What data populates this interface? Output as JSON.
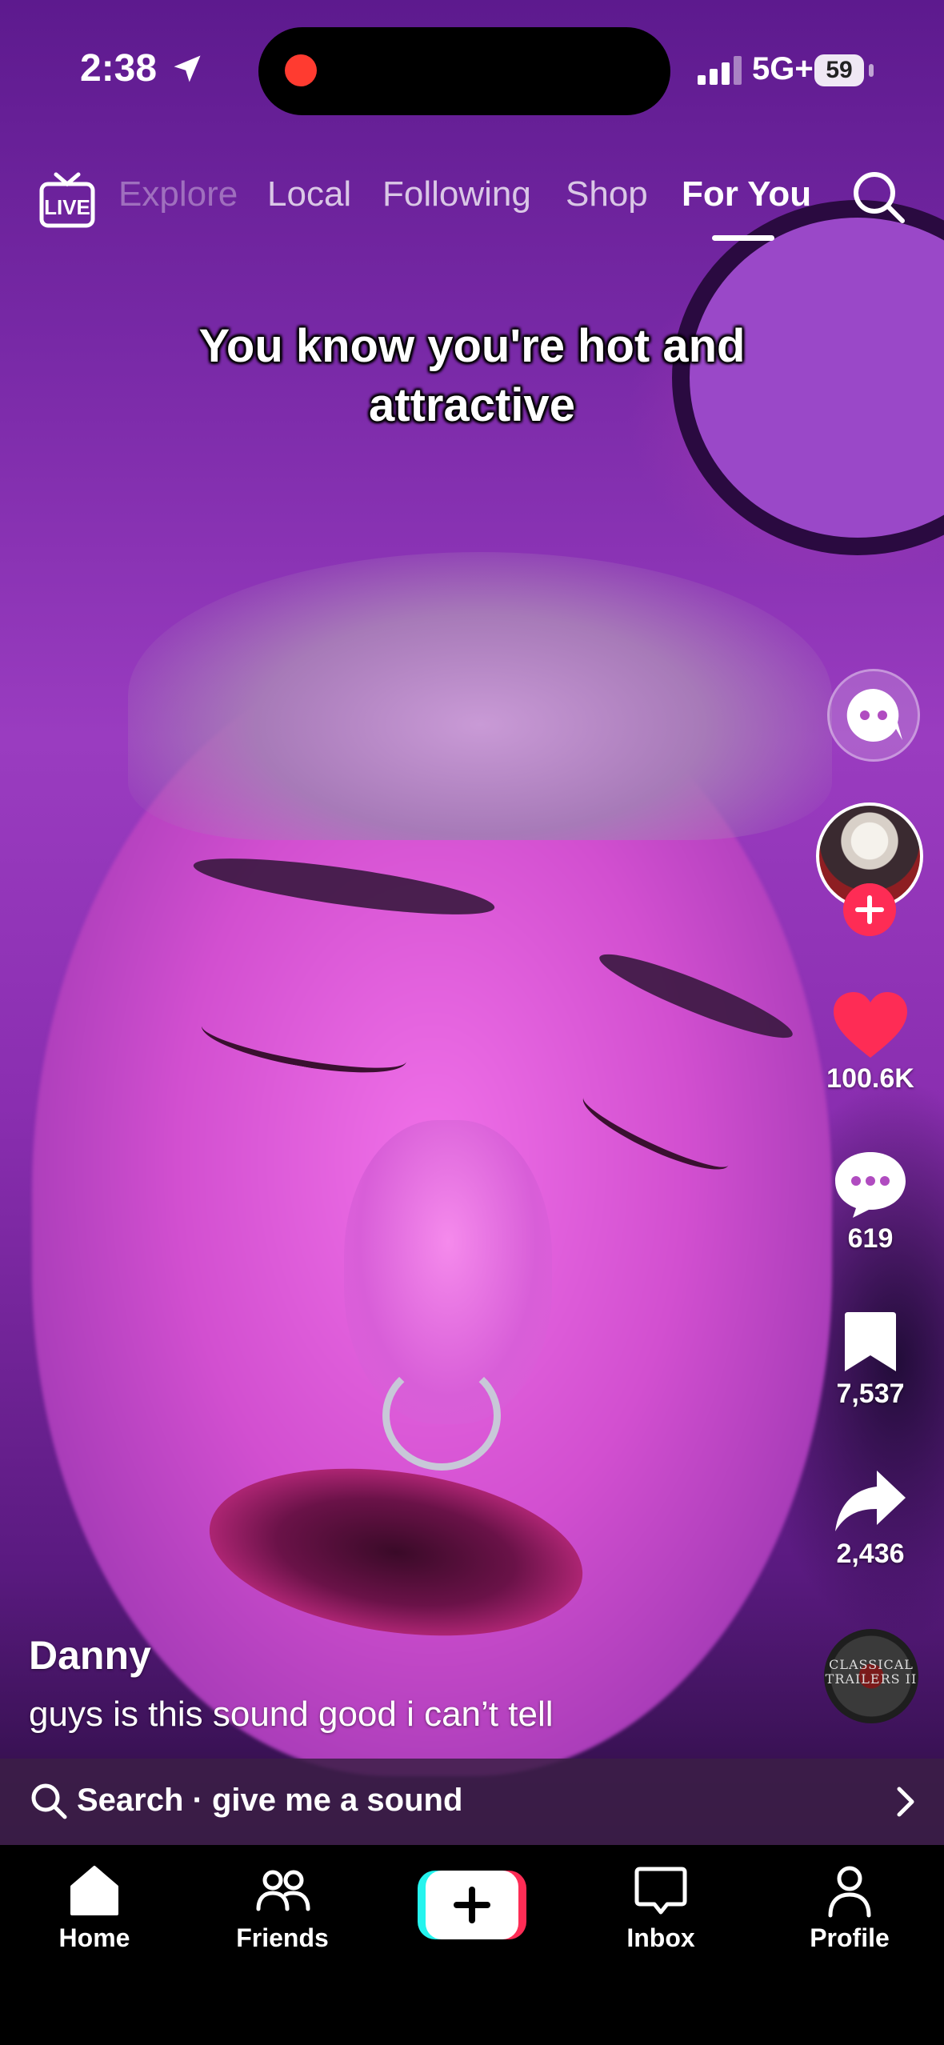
{
  "status_bar": {
    "time": "2:38",
    "network": "5G+",
    "battery": "59"
  },
  "top_nav": {
    "tabs": [
      "Explore",
      "Local",
      "Following",
      "Shop",
      "For You"
    ],
    "active_tab": "For You",
    "live_icon": "live-tv-icon",
    "search_icon": "search-icon"
  },
  "video": {
    "overlay_text": "You know you're hot and attractive",
    "author": "Danny",
    "caption": "guys is this sound good i can’t tell"
  },
  "actions": {
    "likes": "100.6K",
    "comments": "619",
    "saves": "7,537",
    "shares": "2,436",
    "music_disc_text": "CLASSICAL TRAILERS II"
  },
  "search_bar": {
    "label": "Search · give me a sound"
  },
  "bottom_nav": {
    "home": "Home",
    "friends": "Friends",
    "inbox": "Inbox",
    "profile": "Profile"
  },
  "colors": {
    "accent_red": "#fe2c55",
    "accent_cyan": "#25f4ee",
    "video_purple": "#8a2eb0"
  }
}
